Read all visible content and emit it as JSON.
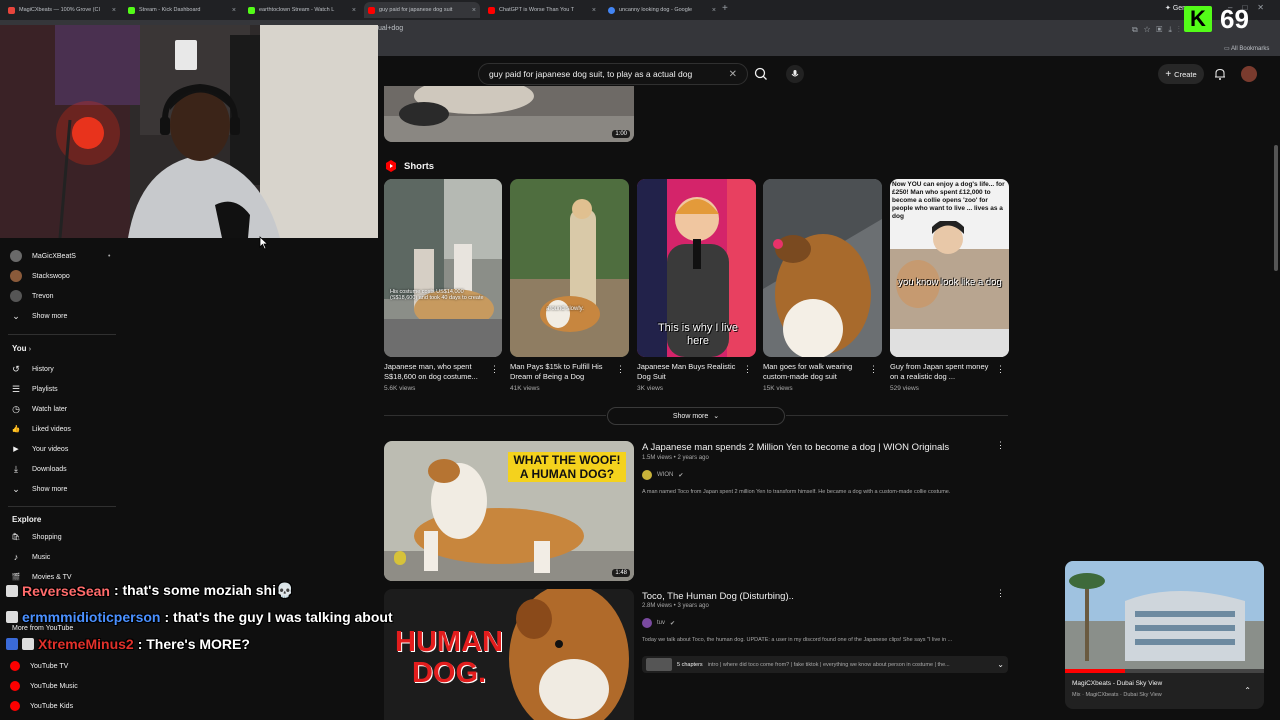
{
  "browser": {
    "tabs": [
      {
        "title": "MagiCXbeats — 100% Grove (CI",
        "color": "#e8453c"
      },
      {
        "title": "Stream - Kick Dashboard",
        "color": "#53fc18"
      },
      {
        "title": "earthtoclown Stream - Watch L",
        "color": "#53fc18"
      },
      {
        "title": "guy paid for japanese dog suit",
        "color": "#ff0000"
      },
      {
        "title": "ChatGPT is Worse Than You T",
        "color": "#ff0000"
      },
      {
        "title": "uncanny looking dog - Google",
        "color": "#4285f4"
      }
    ],
    "url": "ual+dog",
    "all_bookmarks": "All Bookmarks",
    "gemini_label": "Gem"
  },
  "kick": {
    "logo": "K",
    "count": "69"
  },
  "search": {
    "query": "guy paid for japanese dog suit, to play as a actual dog"
  },
  "masthead": {
    "create_label": "Create"
  },
  "sidebar": {
    "subscriptions": [
      {
        "name": "MaGicXBeatS",
        "color": "#6a6a6a",
        "dot": "•"
      },
      {
        "name": "Stackswopo",
        "color": "#8a5a3a"
      },
      {
        "name": "Trevon",
        "color": "#555"
      }
    ],
    "sub_show_more": "Show more",
    "you_label": "You",
    "you_items": [
      {
        "label": "History",
        "icon": "history-icon",
        "glyph": "↺"
      },
      {
        "label": "Playlists",
        "icon": "playlists-icon",
        "glyph": "☰"
      },
      {
        "label": "Watch later",
        "icon": "watch-later-icon",
        "glyph": "◷"
      },
      {
        "label": "Liked videos",
        "icon": "thumbs-up-icon",
        "glyph": "👍"
      },
      {
        "label": "Your videos",
        "icon": "your-videos-icon",
        "glyph": "▶"
      },
      {
        "label": "Downloads",
        "icon": "download-icon",
        "glyph": "⤓"
      }
    ],
    "you_show_more": "Show more",
    "explore_label": "Explore",
    "explore_items": [
      {
        "label": "Shopping",
        "icon": "shopping-bag-icon",
        "glyph": "🛍"
      },
      {
        "label": "Music",
        "icon": "music-note-icon",
        "glyph": "♪"
      },
      {
        "label": "Movies & TV",
        "icon": "film-icon",
        "glyph": "🎬"
      }
    ],
    "more_from_label": "More from YouTube",
    "more_items": [
      {
        "label": "YouTube TV",
        "color": "#ff0000"
      },
      {
        "label": "YouTube Music",
        "color": "#ff0000"
      },
      {
        "label": "YouTube Kids",
        "color": "#ff0000"
      }
    ]
  },
  "chat": [
    {
      "user": "ReverseSean",
      "message": ": that's some moziah shi💀",
      "color": "#ff6b6b"
    },
    {
      "user": "ermmmidioticperson",
      "message": ": that's the guy I was talking about",
      "color": "#4a90ff"
    },
    {
      "user": "XtremeMinus2",
      "message": ": There's MORE?",
      "color": "#e0302a"
    }
  ],
  "top_video": {
    "duration": "1:00"
  },
  "shorts": {
    "heading": "Shorts",
    "items": [
      {
        "title": "Japanese man, who spent S$18,600 on dog costume...",
        "views": "5.6K views",
        "overlay": "His costume costs US$14,000 (S$18,600) and took 40 days to create"
      },
      {
        "title": "Man Pays $15k to Fulfill His Dream of Being a Dog",
        "views": "41K views",
        "overlay": "around slowly."
      },
      {
        "title": "Japanese Man Buys Realistic Dog Suit",
        "views": "3K views",
        "overlay": "This is why I live here"
      },
      {
        "title": "Man goes for walk wearing custom-made dog suit",
        "views": "15K views",
        "overlay": ""
      },
      {
        "title": "Guy from Japan spent money on a realistic dog ...",
        "views": "529 views",
        "overlay": "you know look like a dog",
        "top_text": "Now YOU can enjoy a dog's life... for £250! Man who spent £12,000 to become a collie opens 'zoo' for people who want to live ... lives as a dog"
      }
    ],
    "show_more": "Show more"
  },
  "videos": [
    {
      "title": "A Japanese man spends 2 Million Yen to become a dog | WION Originals",
      "meta": "1.5M views • 2 years ago",
      "channel": "WION",
      "desc": "A man named Toco from Japan spent 2 million Yen to transform himself. He became a dog with a custom-made collie costume.",
      "duration": "1:48",
      "thumb_text": "WHAT THE WOOF! A HUMAN DOG?"
    },
    {
      "title": "Toco, The Human Dog (Disturbing)..",
      "meta": "2.8M views • 3 years ago",
      "channel": "tuv",
      "desc": "Today we talk about Toco, the human dog. UPDATE: a user in my discord found one of the Japanese clips! She says \"I live in ...",
      "thumb_text": "HUMAN DOG.",
      "chapters": "5 chapters",
      "chapters_text": "intro | where did toco come from? | fake tiktok | everything we know about person in costume | the..."
    }
  ],
  "miniplayer": {
    "title": "MagiCXbeats - Dubai Sky View",
    "subtitle": "Mix · MagiCXbeats · Dubai Sky View"
  }
}
